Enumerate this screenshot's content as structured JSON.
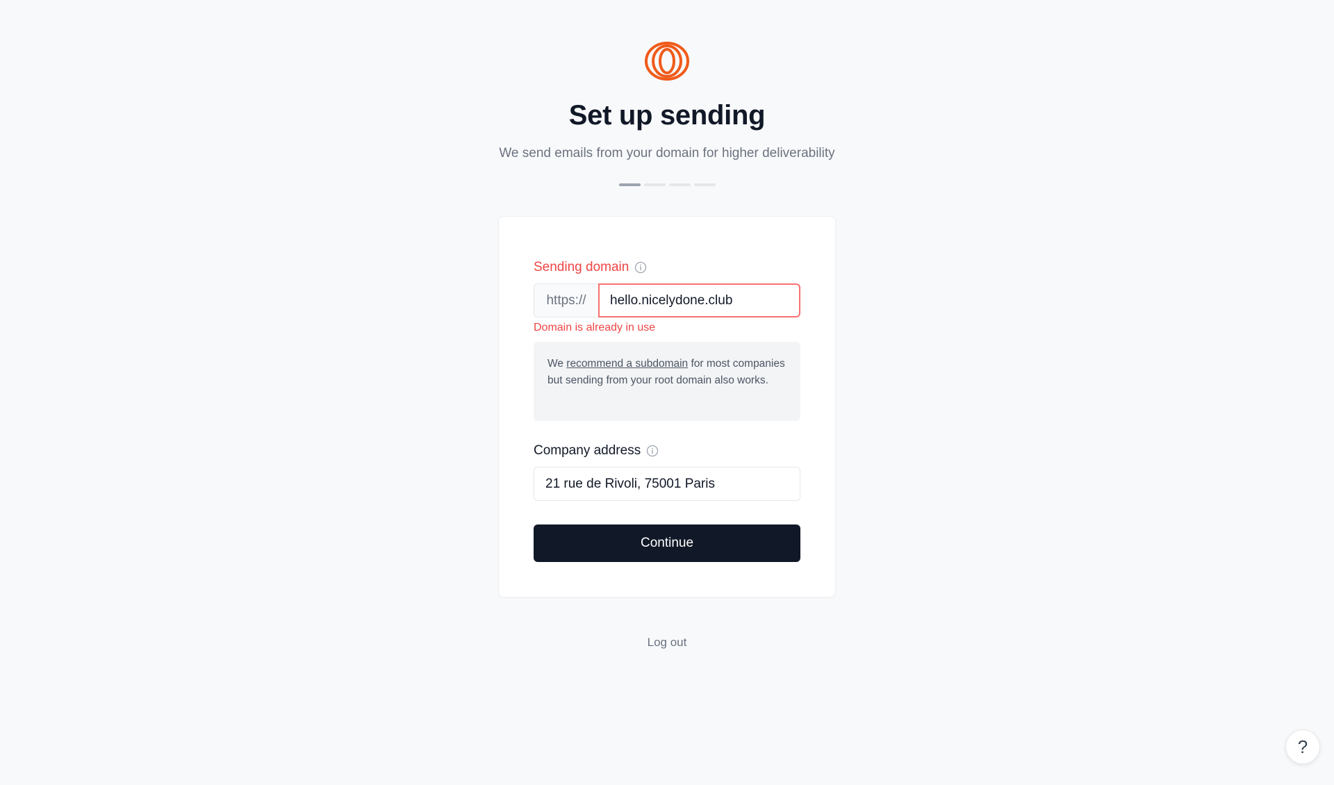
{
  "header": {
    "title": "Set up sending",
    "subtitle": "We send emails from your domain for higher deliverability"
  },
  "progress": {
    "total_steps": 4,
    "current_step": 1
  },
  "form": {
    "sending_domain": {
      "label": "Sending domain",
      "prefix": "https://",
      "value": "hello.nicelydone.club",
      "error": "Domain is already in use"
    },
    "hint": {
      "before": "We ",
      "link": "recommend a subdomain",
      "after": " for most companies but sending from your root domain also works."
    },
    "company_address": {
      "label": "Company address",
      "value": "21 rue de Rivoli, 75001 Paris"
    },
    "continue_label": "Continue"
  },
  "footer": {
    "logout_label": "Log out"
  },
  "help_button": {
    "label": "?"
  },
  "colors": {
    "brand": "#f05a1a",
    "error": "#ef4444",
    "primary_button": "#111827",
    "background": "#f8f9fa"
  },
  "icons": [
    "logo-rings-icon",
    "info-icon",
    "help-icon"
  ]
}
